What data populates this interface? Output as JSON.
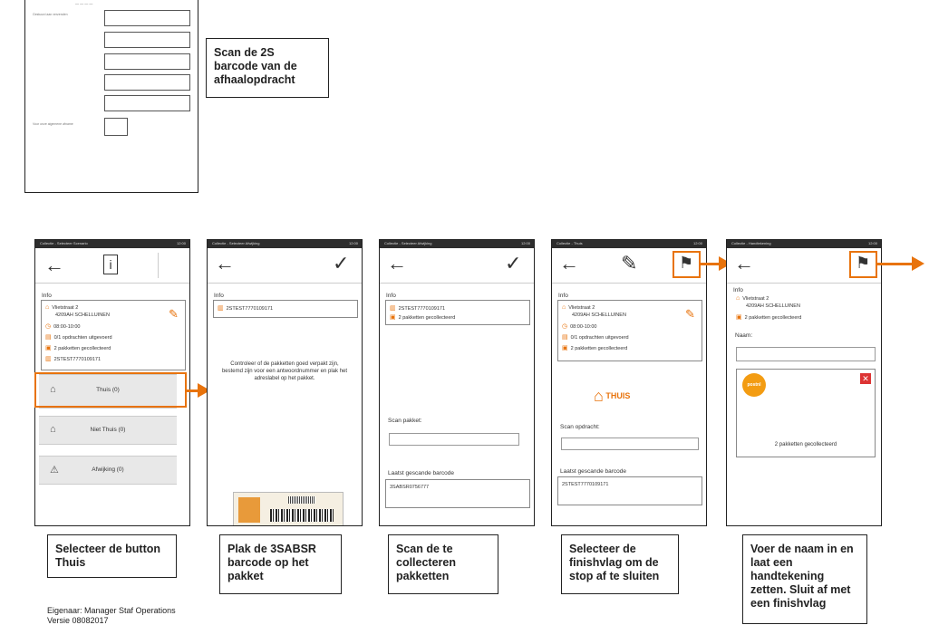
{
  "top_note": "Scan de 2S barcode van de afhaalopdracht",
  "form": {
    "label1": "Gestuurd aan verzenden",
    "label2": "Voor onze algemene afname"
  },
  "screen1": {
    "status_left": "Collectie - Selecteer Scenario",
    "status_right": "12:00",
    "info_label": "Info",
    "address_line1": "Vlietstraat 2",
    "address_line2": "4209AH SCHELLUINEN",
    "time": "08:00-10:00",
    "orders": "0/1 opdrachten uitgevoerd",
    "packages": "2 pakketten gecollecteerd",
    "barcode": "2STEST7770109171",
    "btn_home": "Thuis (0)",
    "btn_not_home": "Niet Thuis (0)",
    "btn_deviation": "Afwijking (0)"
  },
  "screen2": {
    "status_left": "Collectie - Selecteer Afwijking",
    "status_right": "12:00",
    "info_label": "Info",
    "barcode": "2STEST7770109171",
    "message": "Controleer of de pakketten goed verpakt zijn, bestemd zijn voor een antwoordnummer en plak het adreslabel op het pakket."
  },
  "screen3": {
    "status_left": "Collectie - Selecteer Afwijking",
    "status_right": "12:00",
    "info_label": "Info",
    "barcode": "2STEST7770109171",
    "packages": "2 pakketten gecollecteerd",
    "scan_label": "Scan pakket:",
    "last_label": "Laatst gescande barcode",
    "last_value": "3SABSR0756777"
  },
  "screen4": {
    "status_left": "Collectie - Thuis",
    "status_right": "12:00",
    "info_label": "Info",
    "address_line1": "Vlietstraat 2",
    "address_line2": "4209AH SCHELLUINEN",
    "time": "08:00-10:00",
    "orders": "0/1 opdrachten uitgevoerd",
    "packages": "2 pakketten gecollecteerd",
    "home_label": "THUIS",
    "scan_label": "Scan opdracht:",
    "last_label": "Laatst gescande barcode",
    "last_value": "2STEST7770109171"
  },
  "screen5": {
    "status_left": "Collectie - Handtekening",
    "status_right": "12:00",
    "info_label": "Info",
    "address_line1": "Vlietstraat 2",
    "address_line2": "4209AH SCHELLUINEN",
    "packages": "2 pakketten gecollecteerd",
    "name_label": "Naam:",
    "logo_text": "postnl",
    "signature_caption": "2 pakketten gecollecteerd"
  },
  "notes": {
    "n1": "Selecteer de button Thuis",
    "n2": "Plak de 3SABSR barcode op het pakket",
    "n3": "Scan de te collecteren pakketten",
    "n4": "Selecteer de finishvlag om de stop af te sluiten",
    "n5": "Voer de naam in en laat een handtekening zetten. Sluit af met een finishvlag"
  },
  "footer": {
    "owner": "Eigenaar: Manager Staf Operations",
    "version": "Versie 08082017"
  },
  "colors": {
    "accent": "#e8730c",
    "button_bg": "#e8e8e8"
  }
}
